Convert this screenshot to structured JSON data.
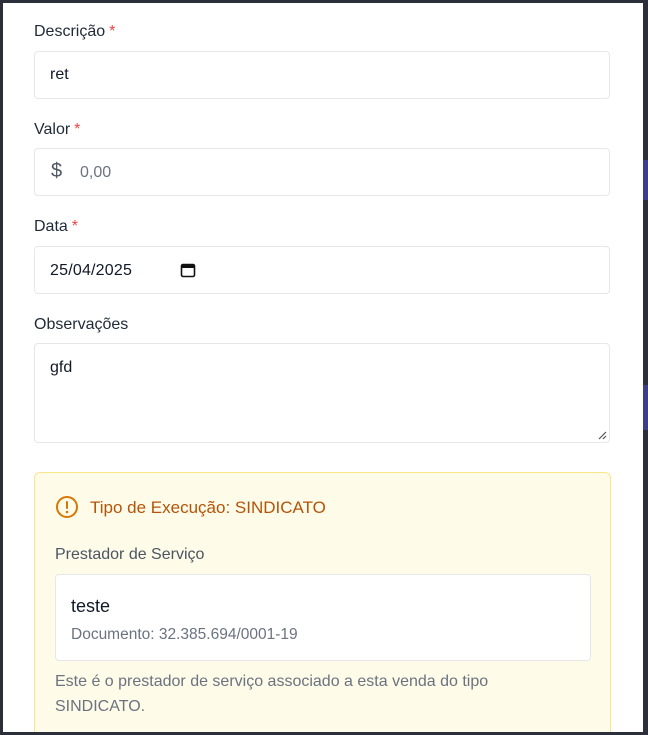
{
  "form": {
    "descricao": {
      "label": "Descrição",
      "required_mark": "*",
      "value": "ret"
    },
    "valor": {
      "label": "Valor",
      "required_mark": "*",
      "currency_symbol": "$",
      "placeholder": "0,00"
    },
    "data": {
      "label": "Data",
      "required_mark": "*",
      "value": "25/04/2025"
    },
    "observacoes": {
      "label": "Observações",
      "value": "gfd"
    }
  },
  "execution_info": {
    "title": "Tipo de Execução: SINDICATO",
    "provider_label": "Prestador de Serviço",
    "provider_name": "teste",
    "provider_document": "Documento: 32.385.694/0001-19",
    "note": "Este é o prestador de serviço associado a esta venda do tipo SINDICATO."
  },
  "colors": {
    "required": "#ef4444",
    "warning_text": "#b45309",
    "warning_bg": "#fefce8",
    "warning_border": "#fde68a"
  },
  "icons": {
    "currency": "dollar-icon",
    "date": "calendar-icon",
    "warning": "alert-circle-icon",
    "resize": "resize-handle-icon"
  }
}
